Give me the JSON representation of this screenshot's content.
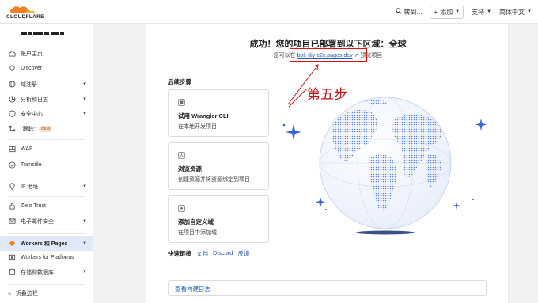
{
  "header": {
    "brand": "CLOUDFLARE",
    "goto_label": "转到...",
    "add_label": "添加",
    "support_label": "支持",
    "language_label": "简体中文"
  },
  "sidebar": {
    "items": [
      {
        "label": "帐户主页",
        "icon": "home-icon",
        "caret": false
      },
      {
        "label": "Discover",
        "icon": "bulb-icon",
        "caret": false
      },
      {
        "label": "域注册",
        "icon": "globe-icon",
        "caret": true
      },
      {
        "label": "分析和日志",
        "icon": "chart-icon",
        "caret": true
      },
      {
        "label": "安全中心",
        "icon": "shield-icon",
        "caret": true
      },
      {
        "label": "\"跟踪\"",
        "icon": "tree-icon",
        "caret": false,
        "badge": "Beta"
      },
      {
        "label": "WAF",
        "icon": "firewall-icon",
        "caret": false
      },
      {
        "label": "Turnstile",
        "icon": "turnstile-icon",
        "caret": false
      },
      {
        "label": "IP 地址",
        "icon": "location-icon",
        "caret": true
      },
      {
        "label": "Zero Trust",
        "icon": "zero-trust-icon",
        "caret": false
      },
      {
        "label": "电子邮件安全",
        "icon": "mail-icon",
        "caret": true
      },
      {
        "label": "Workers 和 Pages",
        "icon": "workers-icon",
        "caret": true,
        "active": true
      },
      {
        "label": "Workers for Platforms",
        "icon": "platforms-icon",
        "caret": false
      },
      {
        "label": "存储和数据库",
        "icon": "database-icon",
        "caret": true
      }
    ],
    "collapse_label": "折叠边栏"
  },
  "main": {
    "title": "成功！您的项目已部署到以下区域：全球",
    "subtitle_prefix": "您可以在",
    "deploy_link": "bolt-diy-c2c.pages.dev",
    "subtitle_suffix": "预览项目",
    "annotation": "第五步",
    "next_steps_heading": "后续步骤",
    "cards": [
      {
        "title": "试用 Wrangler CLI",
        "desc": "在本地开发项目",
        "icon": "terminal-icon"
      },
      {
        "title": "浏览资源",
        "desc": "创建资源并将资源绑定到项目",
        "icon": "resources-icon"
      },
      {
        "title": "添加自定义域",
        "desc": "在项目中添加域",
        "icon": "domain-icon"
      }
    ],
    "quick_links_label": "快速链接",
    "quick_links": [
      "文档",
      "Discord",
      "反馈"
    ],
    "build_log_label": "查看构建日志"
  },
  "colors": {
    "link": "#1f5bbd",
    "annotation_red": "#c0171b",
    "active_nav_bg": "#dfe9f8",
    "globe_blue": "#5b82e8"
  }
}
